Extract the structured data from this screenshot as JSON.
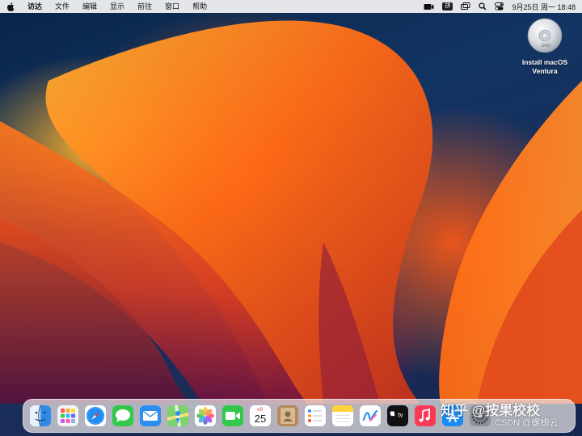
{
  "menubar": {
    "app_name": "访达",
    "items": [
      "文件",
      "编辑",
      "显示",
      "前往",
      "窗口",
      "帮助"
    ],
    "ime_label": "拼",
    "clock": "9月25日 周一  18:48"
  },
  "desktop": {
    "installer_label_line1": "Install macOS",
    "installer_label_line2": "Ventura",
    "installer_disc_text": "DVD"
  },
  "dock": {
    "apps": [
      {
        "name": "Finder",
        "icon": "finder-icon"
      },
      {
        "name": "Launchpad",
        "icon": "launchpad-icon"
      },
      {
        "name": "Safari",
        "icon": "safari-icon"
      },
      {
        "name": "Messages",
        "icon": "messages-icon"
      },
      {
        "name": "Mail",
        "icon": "mail-icon"
      },
      {
        "name": "Maps",
        "icon": "maps-icon"
      },
      {
        "name": "Photos",
        "icon": "photos-icon"
      },
      {
        "name": "FaceTime",
        "icon": "facetime-icon"
      },
      {
        "name": "Calendar",
        "icon": "calendar-icon"
      },
      {
        "name": "Contacts",
        "icon": "contacts-icon"
      },
      {
        "name": "Reminders",
        "icon": "reminders-icon"
      },
      {
        "name": "Notes",
        "icon": "notes-icon"
      },
      {
        "name": "Freeform",
        "icon": "freeform-icon"
      },
      {
        "name": "TV",
        "icon": "tv-icon"
      },
      {
        "name": "Music",
        "icon": "music-icon"
      },
      {
        "name": "App Store",
        "icon": "app-store-icon"
      },
      {
        "name": "System Settings",
        "icon": "settings-icon"
      }
    ],
    "calendar_month": "9月",
    "calendar_day": "25",
    "tv_label": "tv"
  },
  "watermark": {
    "line1": "知乎 @按果校校",
    "line2": "CSDN @螺蛳云"
  },
  "colors": {
    "menubar_bg": "#f6f6f6",
    "wallpaper_orange": "#ff7319",
    "wallpaper_navy": "#0d2a4f"
  }
}
